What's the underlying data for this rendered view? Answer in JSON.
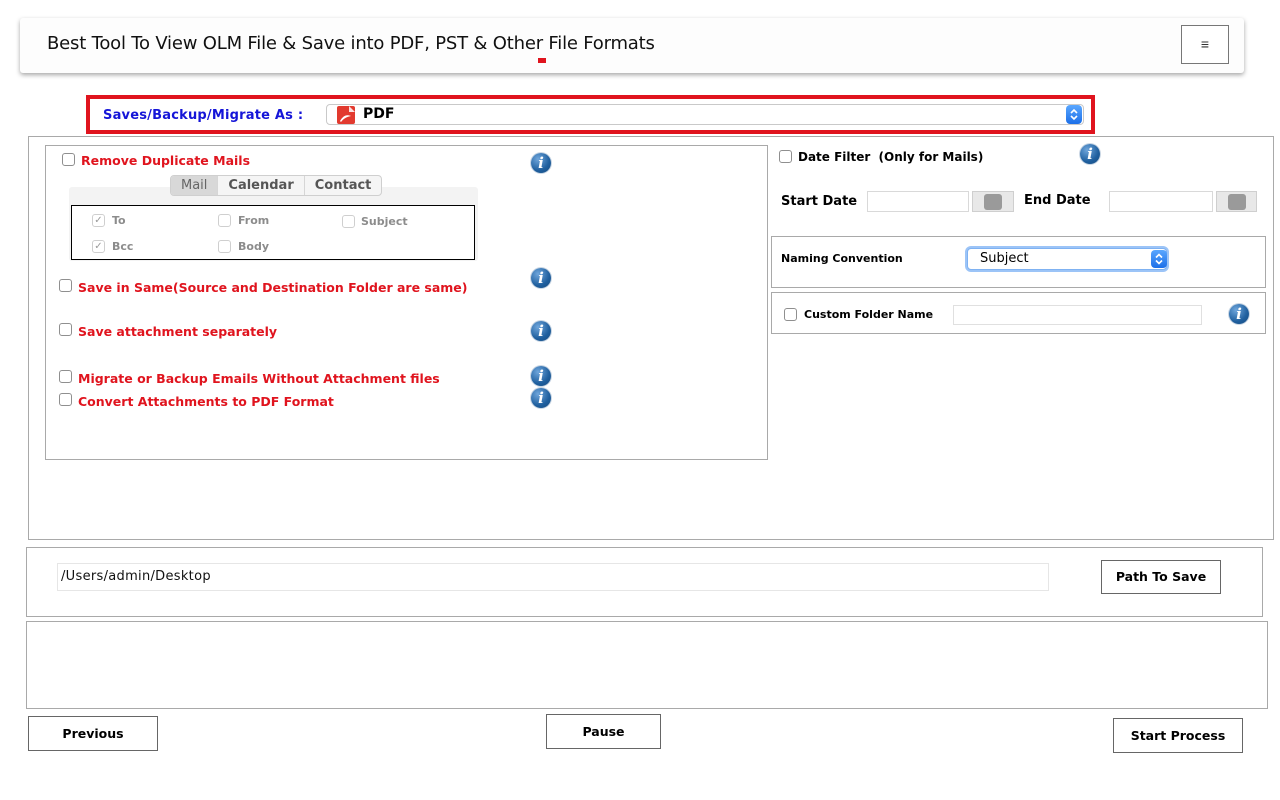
{
  "header": {
    "title": "Best Tool To View OLM File & Save into PDF, PST & Other File Formats",
    "menu_icon": "hamburger-menu-icon",
    "menu_glyph": "≡"
  },
  "format": {
    "label": "Saves/Backup/Migrate As :",
    "selected": "PDF",
    "icon": "pdf-file-icon"
  },
  "left_options": {
    "remove_duplicates": "Remove Duplicate Mails",
    "tabs": [
      {
        "label": "Mail",
        "active": true
      },
      {
        "label": "Calendar",
        "active": false
      },
      {
        "label": "Contact",
        "active": false
      }
    ],
    "fields": [
      {
        "label": "To",
        "checked": true
      },
      {
        "label": "From",
        "checked": false
      },
      {
        "label": "Subject",
        "checked": false
      },
      {
        "label": "Bcc",
        "checked": true
      },
      {
        "label": "Body",
        "checked": false
      }
    ],
    "save_in_same": "Save in Same(Source and Destination Folder are same)",
    "save_attachment": "Save attachment separately",
    "without_attachment": "Migrate or Backup Emails Without Attachment files",
    "convert_attachments": "Convert Attachments to PDF Format",
    "info_glyph": "i"
  },
  "right_options": {
    "date_filter": "Date Filter",
    "date_filter_note": "(Only for Mails)",
    "start_date": "Start Date",
    "end_date": "End Date",
    "start_date_value": "",
    "end_date_value": "",
    "naming_label": "Naming Convention",
    "naming_value": "Subject",
    "custom_folder": "Custom Folder Name",
    "custom_folder_value": "",
    "info_glyph": "i"
  },
  "path": {
    "value": "/Users/admin/Desktop",
    "button": "Path To Save"
  },
  "footer": {
    "previous": "Previous",
    "pause": "Pause",
    "start": "Start Process"
  },
  "colors": {
    "accent_red": "#e0141e",
    "label_blue": "#1515d8",
    "info_blue": "#1f5f9e"
  }
}
